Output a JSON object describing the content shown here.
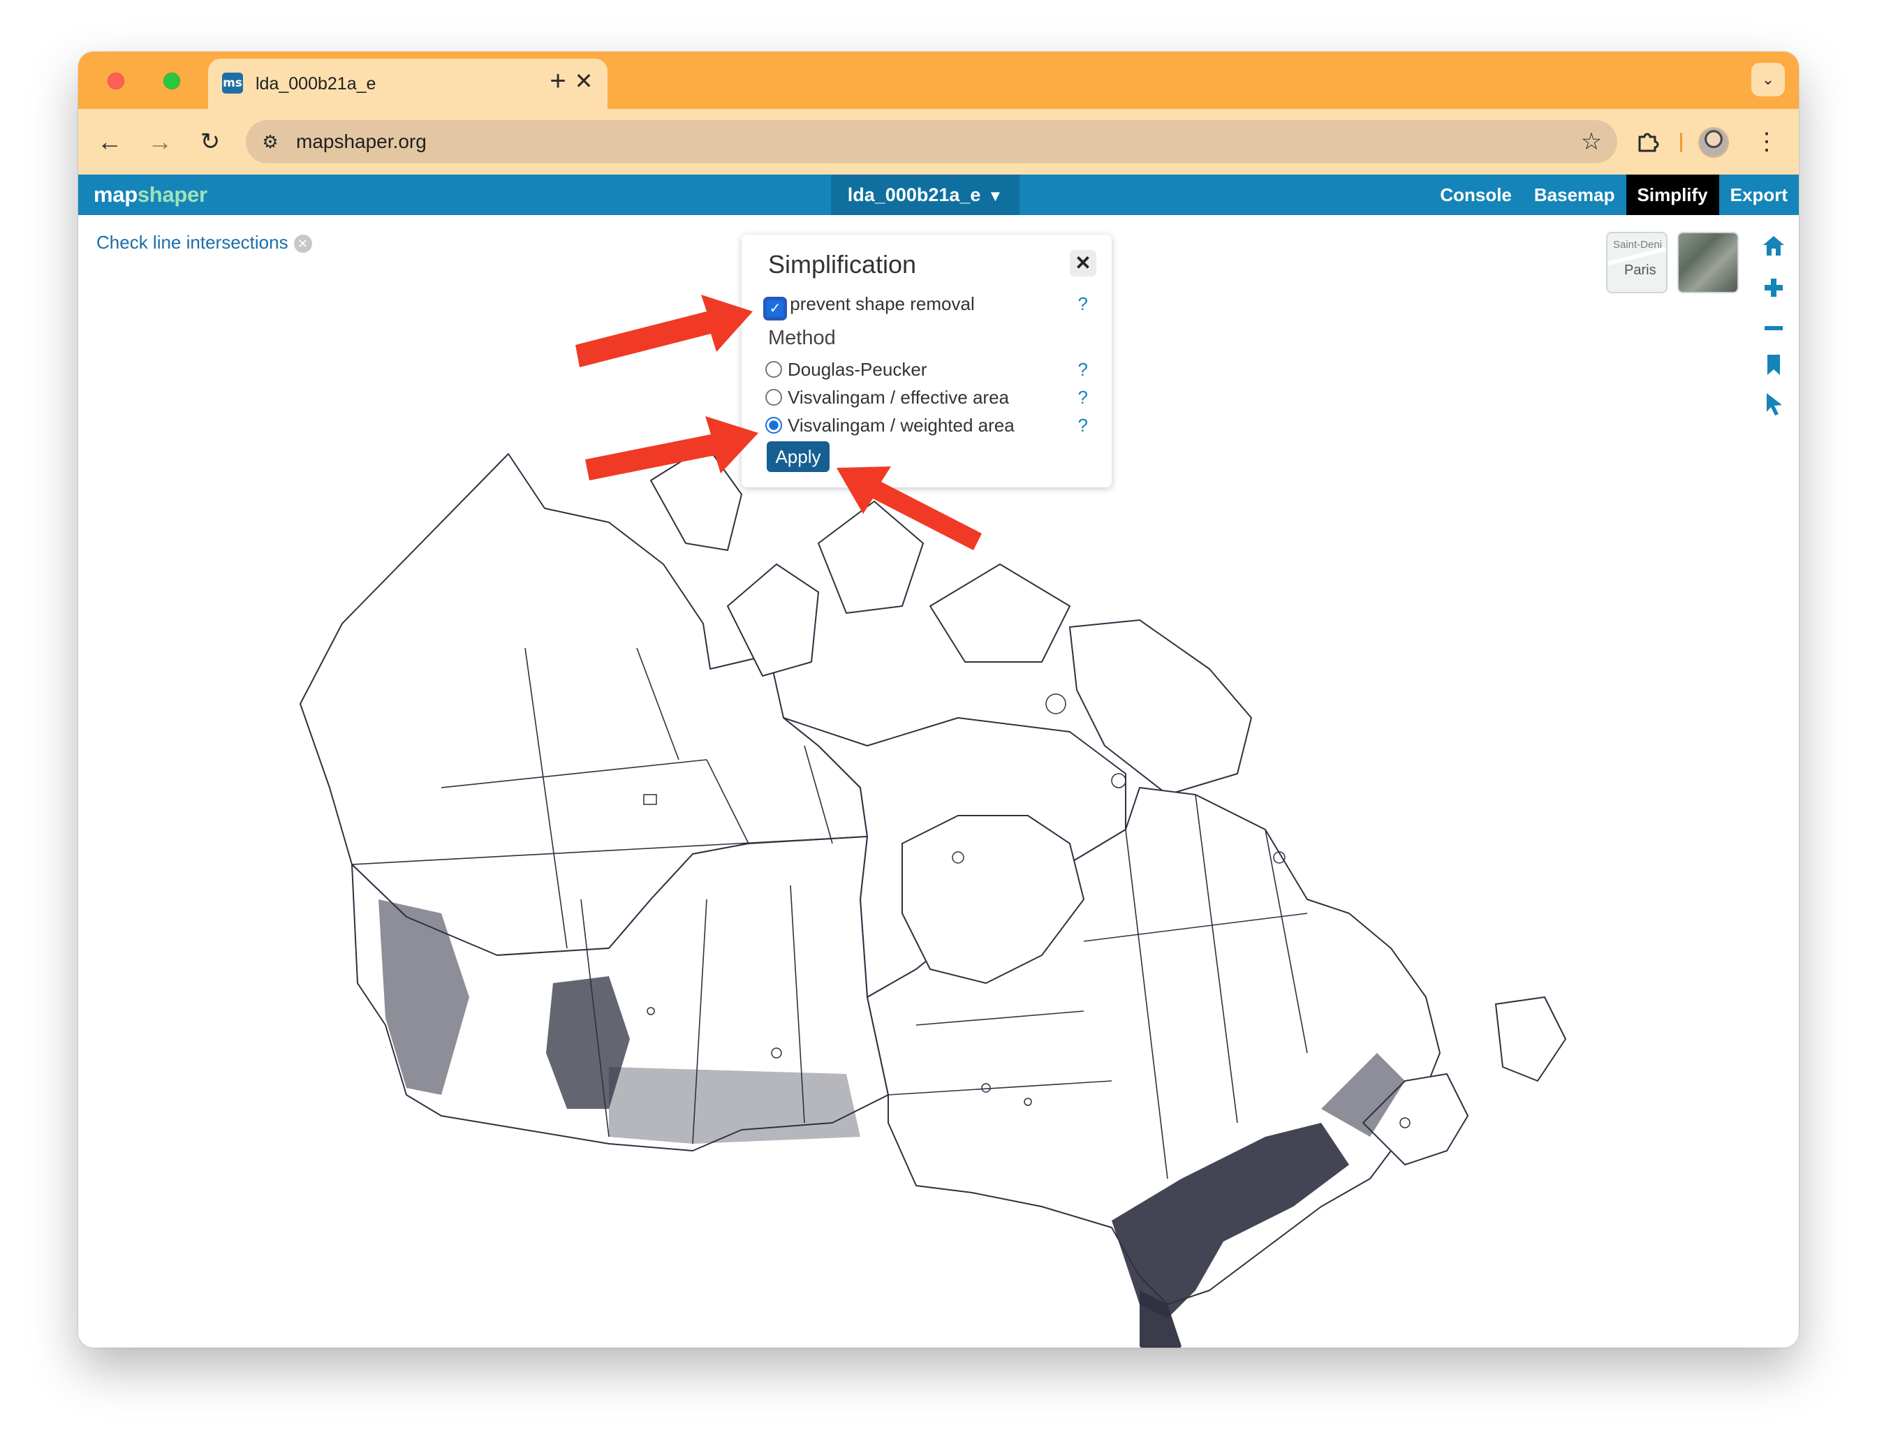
{
  "browser": {
    "tab_title": "lda_000b21a_e",
    "tab_close": "✕",
    "new_tab": "+",
    "url": "mapshaper.org"
  },
  "app": {
    "logo_part1": "map",
    "logo_part2": "shaper",
    "layer_name": "lda_000b21a_e",
    "layer_caret": "▼",
    "nav": [
      "Console",
      "Basemap",
      "Simplify",
      "Export"
    ],
    "active_nav": "Simplify"
  },
  "map": {
    "intersections_link": "Check line intersections",
    "basemaps": [
      {
        "name": "street",
        "label_top": "Saint-Deni",
        "label_main": "Paris"
      },
      {
        "name": "satellite"
      }
    ],
    "tools": [
      "home-icon",
      "zoom-in-icon",
      "zoom-out-icon",
      "bookmark-icon",
      "pointer-icon"
    ],
    "map_color": "#2f3141"
  },
  "simplify_panel": {
    "title": "Simplification",
    "close": "✕",
    "prevent_shape_removal": {
      "label": "prevent shape removal",
      "checked": true
    },
    "method_label": "Method",
    "methods": [
      {
        "label": "Douglas-Peucker",
        "selected": false
      },
      {
        "label": "Visvalingam / effective area",
        "selected": false
      },
      {
        "label": "Visvalingam / weighted area",
        "selected": true
      }
    ],
    "help": "?",
    "apply_label": "Apply"
  },
  "annotation_color": "#f03a25"
}
